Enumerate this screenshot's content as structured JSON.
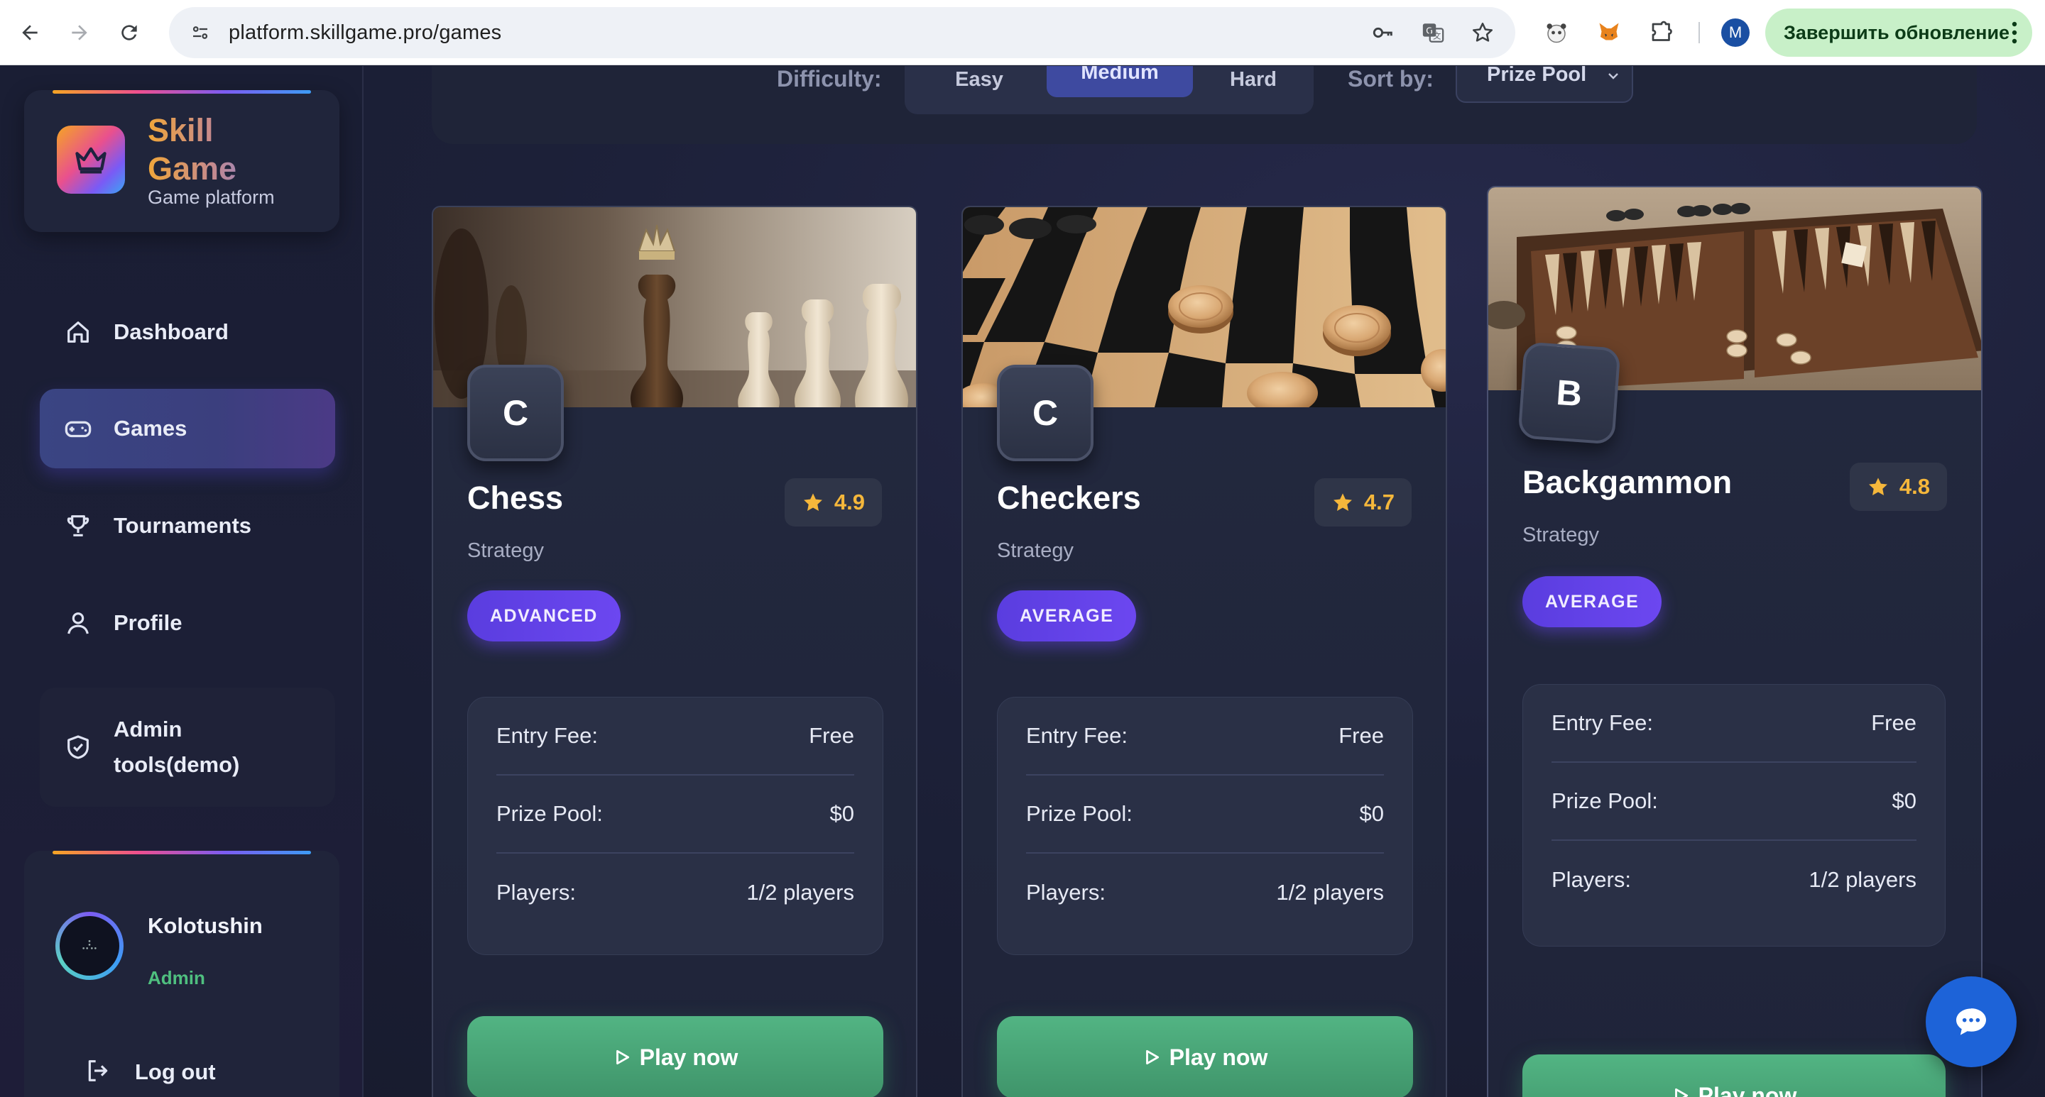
{
  "browser": {
    "url": "platform.skillgame.pro/games",
    "update_button": "Завершить обновление",
    "profile_initial": "M"
  },
  "brand": {
    "name_line1": "Skill",
    "name_line2": "Game",
    "subtitle": "Game platform"
  },
  "sidebar": {
    "items": [
      {
        "label": "Dashboard",
        "icon": "home-icon"
      },
      {
        "label": "Games",
        "icon": "gamepad-icon"
      },
      {
        "label": "Tournaments",
        "icon": "trophy-icon"
      },
      {
        "label": "Profile",
        "icon": "user-icon"
      },
      {
        "label": "Admin tools(demo)",
        "icon": "shield-check-icon"
      }
    ],
    "active": "Games"
  },
  "user": {
    "name": "Kolotushin",
    "role": "Admin",
    "logout": "Log out"
  },
  "filters": {
    "difficulty_label": "Difficulty:",
    "difficulty_options": [
      "Easy",
      "Medium",
      "Hard"
    ],
    "difficulty_selected": "Medium",
    "sort_label": "Sort by:",
    "sort_value": "Prize Pool"
  },
  "games": [
    {
      "letter": "C",
      "title": "Chess",
      "rating": "4.9",
      "category": "Strategy",
      "level": "ADVANCED",
      "entry_fee_label": "Entry Fee:",
      "entry_fee": "Free",
      "prize_pool_label": "Prize Pool:",
      "prize_pool": "$0",
      "players_label": "Players:",
      "players": "1/2 players",
      "play_label": "Play now"
    },
    {
      "letter": "C",
      "title": "Checkers",
      "rating": "4.7",
      "category": "Strategy",
      "level": "AVERAGE",
      "entry_fee_label": "Entry Fee:",
      "entry_fee": "Free",
      "prize_pool_label": "Prize Pool:",
      "prize_pool": "$0",
      "players_label": "Players:",
      "players": "1/2 players",
      "play_label": "Play now"
    },
    {
      "letter": "B",
      "title": "Backgammon",
      "rating": "4.8",
      "category": "Strategy",
      "level": "AVERAGE",
      "entry_fee_label": "Entry Fee:",
      "entry_fee": "Free",
      "prize_pool_label": "Prize Pool:",
      "prize_pool": "$0",
      "players_label": "Players:",
      "players": "1/2 players",
      "play_label": "Play now"
    }
  ],
  "colors": {
    "accent": "#5a3ddf",
    "play": "#4aa878",
    "rating_star": "#f5b73b",
    "role": "#4fbf7f"
  }
}
